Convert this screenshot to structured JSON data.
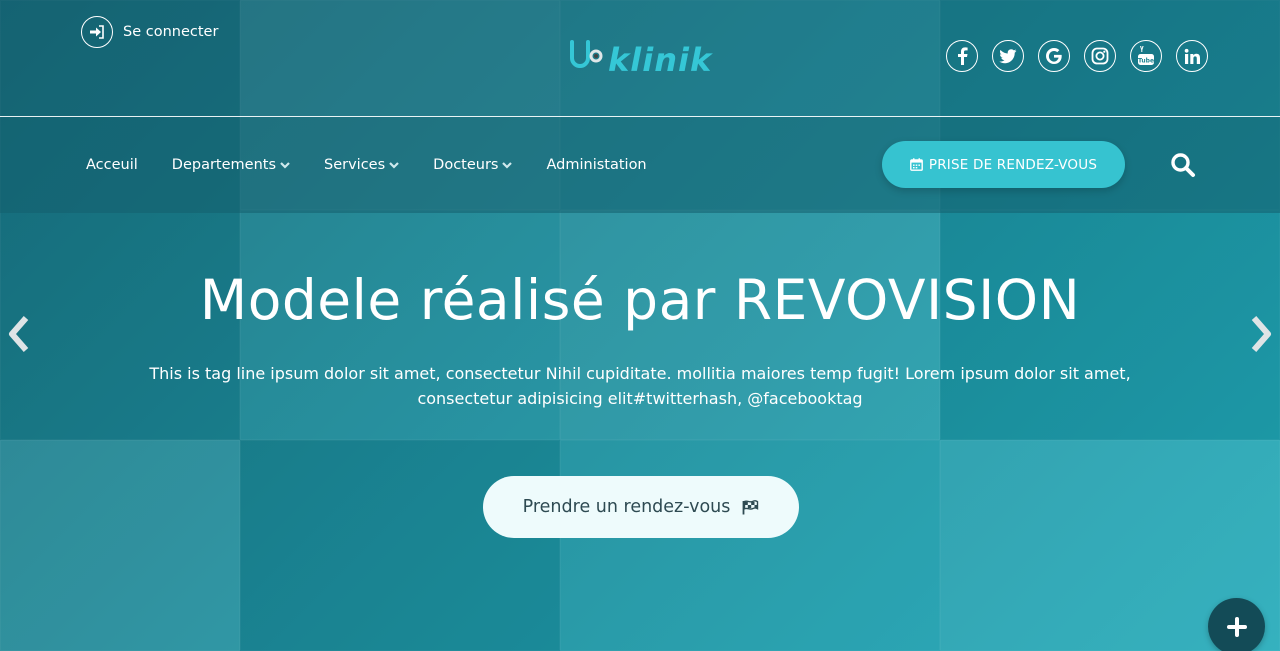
{
  "header": {
    "login_label": "Se connecter",
    "logo_text": "klinik",
    "socials": [
      {
        "name": "facebook",
        "glyph": "f"
      },
      {
        "name": "twitter",
        "glyph": "t"
      },
      {
        "name": "google",
        "glyph": "G"
      },
      {
        "name": "instagram",
        "glyph": ""
      },
      {
        "name": "youtube",
        "glyph": "You"
      },
      {
        "name": "linkedin",
        "glyph": "in"
      }
    ]
  },
  "nav": {
    "items": [
      {
        "label": "Acceuil",
        "dropdown": false
      },
      {
        "label": "Departements",
        "dropdown": true
      },
      {
        "label": "Services",
        "dropdown": true
      },
      {
        "label": "Docteurs",
        "dropdown": true
      },
      {
        "label": "Administation",
        "dropdown": false
      }
    ],
    "appointment_label": "PRISE DE RENDEZ-VOUS"
  },
  "hero": {
    "title": "Modele réalisé par REVOVISION",
    "tagline_line1": "This is tag line ipsum dolor sit amet, consectetur Nihil cupiditate. mollitia maiores temp fugit! Lorem ipsum dolor sit amet,",
    "tagline_line2": "consectetur adipisicing elit#twitterhash, @facebooktag",
    "cta_label": "Prendre un rendez-vous"
  },
  "colors": {
    "accent": "#36c3d0",
    "logo": "#35c7d6",
    "fab": "#134b57",
    "cta_text": "#2e4a52"
  }
}
